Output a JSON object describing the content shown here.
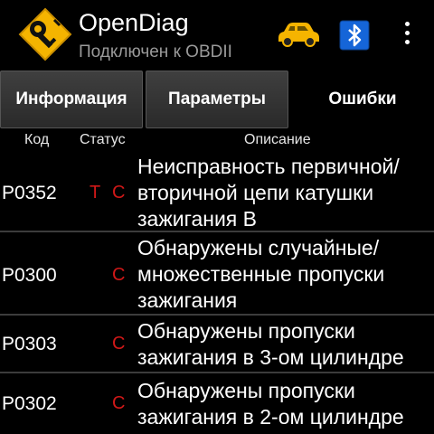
{
  "app": {
    "title": "OpenDiag",
    "subtitle": "Подключен к OBDII",
    "icon": "key-tag-icon",
    "accent_color": "#f5b400"
  },
  "toolbar": {
    "car_icon": "car-icon",
    "bluetooth_icon": "bluetooth-icon",
    "menu_icon": "overflow-menu-icon"
  },
  "tabs": [
    {
      "label": "Информация",
      "active": false
    },
    {
      "label": "Параметры",
      "active": false
    },
    {
      "label": "Ошибки",
      "active": true
    }
  ],
  "table": {
    "headers": {
      "code": "Код",
      "status": "Статус",
      "description": "Описание"
    },
    "status_color": "#d01818",
    "rows": [
      {
        "code": "P0352",
        "status_t": "T",
        "status_c": "C",
        "description": "Неисправность первичной/ вторичной цепи катушки зажигания B"
      },
      {
        "code": "P0300",
        "status_t": "",
        "status_c": "C",
        "description": "Обнаружены случайные/ множественные пропуски зажигания"
      },
      {
        "code": "P0303",
        "status_t": "",
        "status_c": "C",
        "description": "Обнаружены пропуски зажигания в 3-ом цилиндре"
      },
      {
        "code": "P0302",
        "status_t": "",
        "status_c": "C",
        "description": "Обнаружены пропуски зажигания в 2-ом цилиндре"
      }
    ]
  }
}
